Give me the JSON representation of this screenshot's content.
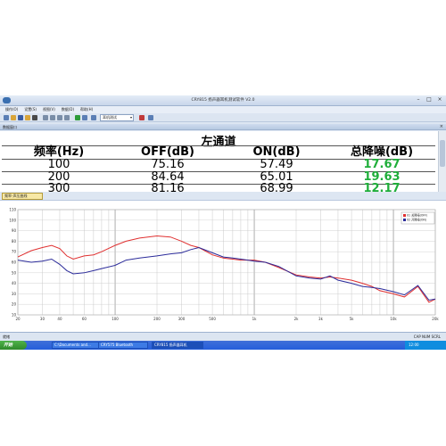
{
  "window": {
    "title": "CRY815 扬声器耳机测试软件 V2.0"
  },
  "menubar": {
    "items": [
      "操作(O)",
      "设置(S)",
      "视图(V)",
      "数据(D)",
      "帮助(H)"
    ]
  },
  "toolbar": {
    "dropdown_value": "耳机测试"
  },
  "panel": {
    "label": "数据窗口"
  },
  "table": {
    "title": "左通道",
    "headers": [
      "频率(Hz)",
      "OFF(dB)",
      "ON(dB)",
      "总降噪(dB)"
    ],
    "rows": [
      [
        "100",
        "75.16",
        "57.49",
        "17.67"
      ],
      [
        "200",
        "84.64",
        "65.01",
        "19.63"
      ],
      [
        "300",
        "81.16",
        "68.99",
        "12.17"
      ]
    ]
  },
  "chart_tab": {
    "label": "频率-声压曲线"
  },
  "statusbar": {
    "ready": "就绪",
    "info": "CAP NUM SCRL"
  },
  "taskbar": {
    "start": "开始",
    "items": [
      "C:\\Documents and...",
      "CRY575 Bluetooth",
      "CRY815 扬声器耳机"
    ],
    "tray": "12:00"
  },
  "colors": {
    "off_series": "#e03030",
    "on_series": "#2b2b9a",
    "reduction_text": "#1fae3a"
  },
  "chart_data": {
    "type": "line",
    "xscale": "log",
    "xlim": [
      20,
      20000
    ],
    "ylim": [
      10,
      110
    ],
    "yticks": [
      10,
      20,
      30,
      40,
      50,
      60,
      70,
      80,
      90,
      100,
      110
    ],
    "xtick_labels": [
      {
        "x": 20,
        "label": "20"
      },
      {
        "x": 30,
        "label": "30"
      },
      {
        "x": 40,
        "label": "40"
      },
      {
        "x": 60,
        "label": "60"
      },
      {
        "x": 100,
        "label": "100"
      },
      {
        "x": 200,
        "label": "200"
      },
      {
        "x": 300,
        "label": "300"
      },
      {
        "x": 500,
        "label": "500"
      },
      {
        "x": 1000,
        "label": "1k"
      },
      {
        "x": 2000,
        "label": "2k"
      },
      {
        "x": 3000,
        "label": "3k"
      },
      {
        "x": 5000,
        "label": "5k"
      },
      {
        "x": 10000,
        "label": "10k"
      },
      {
        "x": 20000,
        "label": "20k"
      }
    ],
    "grid": true,
    "legend_position": "top-right",
    "series": [
      {
        "name": "01 关降噪(OFF)",
        "color": "#e03030",
        "x": [
          20,
          25,
          30,
          35,
          40,
          45,
          50,
          60,
          70,
          80,
          100,
          120,
          150,
          200,
          250,
          300,
          350,
          400,
          500,
          600,
          700,
          800,
          900,
          1000,
          1200,
          1500,
          2000,
          2500,
          3000,
          3500,
          4000,
          5000,
          6000,
          7000,
          8000,
          10000,
          12000,
          15000,
          18000,
          20000
        ],
        "y": [
          65,
          71,
          74,
          76,
          73,
          66,
          63,
          66,
          67,
          70,
          76,
          80,
          83,
          85,
          84,
          80,
          76,
          74,
          67,
          64,
          63,
          62,
          62,
          62,
          60,
          55,
          48,
          46,
          45,
          46,
          45,
          43,
          40,
          37,
          33,
          30,
          27,
          37,
          22,
          25
        ]
      },
      {
        "name": "02 开降噪(ON)",
        "color": "#2b2b9a",
        "x": [
          20,
          25,
          30,
          35,
          40,
          45,
          50,
          60,
          70,
          80,
          100,
          120,
          150,
          200,
          250,
          300,
          350,
          400,
          500,
          600,
          700,
          800,
          900,
          1000,
          1200,
          1500,
          2000,
          2500,
          3000,
          3500,
          4000,
          5000,
          6000,
          7000,
          8000,
          10000,
          12000,
          15000,
          18000,
          20000
        ],
        "y": [
          62,
          60,
          61,
          63,
          58,
          52,
          49,
          50,
          52,
          54,
          57,
          62,
          64,
          66,
          68,
          69,
          72,
          74,
          69,
          65,
          64,
          63,
          62,
          61,
          60,
          56,
          47,
          45,
          44,
          47,
          43,
          40,
          37,
          36,
          35,
          32,
          29,
          38,
          24,
          25
        ]
      }
    ]
  }
}
